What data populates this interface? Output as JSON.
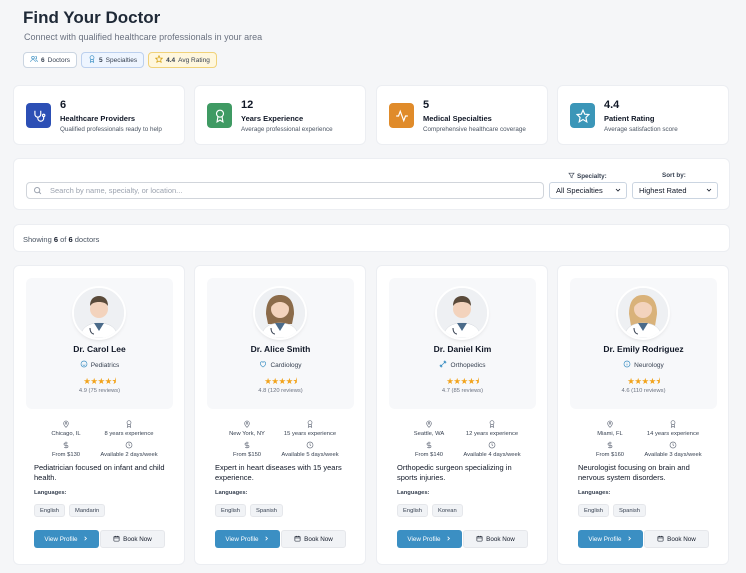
{
  "header": {
    "title": "Find Your Doctor",
    "subtitle": "Connect with qualified healthcare professionals in your area"
  },
  "badges": [
    {
      "value": "6",
      "label": "Doctors"
    },
    {
      "value": "5",
      "label": "Specialties"
    },
    {
      "value": "4.4",
      "label": "Avg Rating"
    }
  ],
  "stats": [
    {
      "value": "6",
      "label": "Healthcare Providers",
      "desc": "Qualified professionals ready to help",
      "color": "#2c4fb5",
      "icon": "stethoscope-icon"
    },
    {
      "value": "12",
      "label": "Years Experience",
      "desc": "Average professional experience",
      "color": "#3f9a63",
      "icon": "award-icon"
    },
    {
      "value": "5",
      "label": "Medical Specialties",
      "desc": "Comprehensive healthcare coverage",
      "color": "#e08b2a",
      "icon": "activity-icon"
    },
    {
      "value": "4.4",
      "label": "Patient Rating",
      "desc": "Average satisfaction score",
      "color": "#3b96b8",
      "icon": "star-icon"
    }
  ],
  "filters": {
    "search_placeholder": "Search by name, specialty, or location...",
    "specialty_label": "Specialty:",
    "specialty_value": "All Specialties",
    "sort_label": "Sort by:",
    "sort_value": "Highest Rated"
  },
  "results": {
    "prefix": "Showing",
    "shown": "6",
    "of": "of",
    "total": "6",
    "suffix": "doctors"
  },
  "doctors": [
    {
      "name": "Dr. Carol Lee",
      "specialty": "Pediatrics",
      "specialty_icon": "smile-icon",
      "stars": "★★★★⯨",
      "reviews": "4.9 (75 reviews)",
      "location": "Chicago, IL",
      "experience": "8 years experience",
      "price": "From $130",
      "availability": "Available 2 days/week",
      "bio": "Pediatrician focused on infant and child health.",
      "languages_label": "Languages:",
      "languages": [
        "English",
        "Mandarin"
      ],
      "view_label": "View Profile",
      "book_label": "Book Now",
      "gender": "m"
    },
    {
      "name": "Dr. Alice Smith",
      "specialty": "Cardiology",
      "specialty_icon": "heart-icon",
      "stars": "★★★★⯨",
      "reviews": "4.8 (120 reviews)",
      "location": "New York, NY",
      "experience": "15 years experience",
      "price": "From $150",
      "availability": "Available 5 days/week",
      "bio": "Expert in heart diseases with 15 years experience.",
      "languages_label": "Languages:",
      "languages": [
        "English",
        "Spanish"
      ],
      "view_label": "View Profile",
      "book_label": "Book Now",
      "gender": "f"
    },
    {
      "name": "Dr. Daniel Kim",
      "specialty": "Orthopedics",
      "specialty_icon": "bone-icon",
      "stars": "★★★★⯨",
      "reviews": "4.7 (85 reviews)",
      "location": "Seattle, WA",
      "experience": "12 years experience",
      "price": "From $140",
      "availability": "Available 4 days/week",
      "bio": "Orthopedic surgeon specializing in sports injuries.",
      "languages_label": "Languages:",
      "languages": [
        "English",
        "Korean"
      ],
      "view_label": "View Profile",
      "book_label": "Book Now",
      "gender": "m"
    },
    {
      "name": "Dr. Emily Rodriguez",
      "specialty": "Neurology",
      "specialty_icon": "brain-icon",
      "stars": "★★★★⯨",
      "reviews": "4.6 (110 reviews)",
      "location": "Miami, FL",
      "experience": "14 years experience",
      "price": "From $160",
      "availability": "Available 3 days/week",
      "bio": "Neurologist focusing on brain and nervous system disorders.",
      "languages_label": "Languages:",
      "languages": [
        "English",
        "Spanish"
      ],
      "view_label": "View Profile",
      "book_label": "Book Now",
      "gender": "f2"
    }
  ]
}
